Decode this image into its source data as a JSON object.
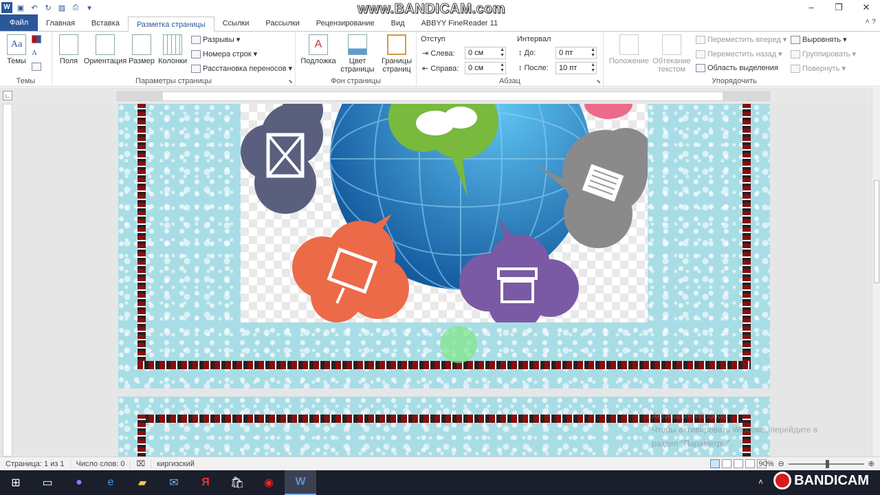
{
  "window": {
    "bandicam_watermark": "www.BANDICAM.com",
    "controls": [
      "–",
      "❐",
      "✕"
    ]
  },
  "tabs": [
    {
      "label": "Файл"
    },
    {
      "label": "Главная"
    },
    {
      "label": "Вставка"
    },
    {
      "label": "Разметка страницы"
    },
    {
      "label": "Ссылки"
    },
    {
      "label": "Рассылки"
    },
    {
      "label": "Рецензирование"
    },
    {
      "label": "Вид"
    },
    {
      "label": "ABBYY FineReader 11"
    }
  ],
  "ribbon": {
    "themes": {
      "button": "Темы",
      "group": "Темы"
    },
    "page_setup": {
      "margins": "Поля",
      "orientation": "Ориентация",
      "size": "Размер",
      "columns": "Колонки",
      "breaks": "Разрывы",
      "line_numbers": "Номера строк",
      "hyphenation": "Расстановка переносов",
      "group": "Параметры страницы"
    },
    "page_background": {
      "watermark": "Подложка",
      "page_color_1": "Цвет",
      "page_color_2": "страницы",
      "page_borders_1": "Границы",
      "page_borders_2": "страниц",
      "group": "Фон страницы"
    },
    "paragraph": {
      "indent_title": "Отступ",
      "left_label": "Слева:",
      "left_value": "0 см",
      "right_label": "Справа:",
      "right_value": "0 см",
      "spacing_title": "Интервал",
      "before_label": "До:",
      "before_value": "0 пт",
      "after_label": "После:",
      "after_value": "10 пт",
      "group": "Абзац"
    },
    "arrange": {
      "position": "Положение",
      "wrap_1": "Обтекание",
      "wrap_2": "текстом",
      "bring_forward": "Переместить вперед",
      "send_backward": "Переместить назад",
      "selection_pane": "Область выделения",
      "align": "Выровнять",
      "group_btn": "Группировать",
      "rotate": "Повернуть",
      "group": "Упорядочить"
    }
  },
  "document": {
    "activation_line1": "Активация Windows",
    "activation_line2": "Чтобы активировать Windows, перейдите в",
    "activation_line3": "раздел \"Параметры\"."
  },
  "statusbar": {
    "page": "Страница: 1 из 1",
    "words": "Число слов: 0",
    "language": "киргизский",
    "zoom": "90%"
  },
  "colors": {
    "accent": "#2b579a",
    "page_bg": "#a8dde6",
    "border_red": "#8b0d0d"
  }
}
